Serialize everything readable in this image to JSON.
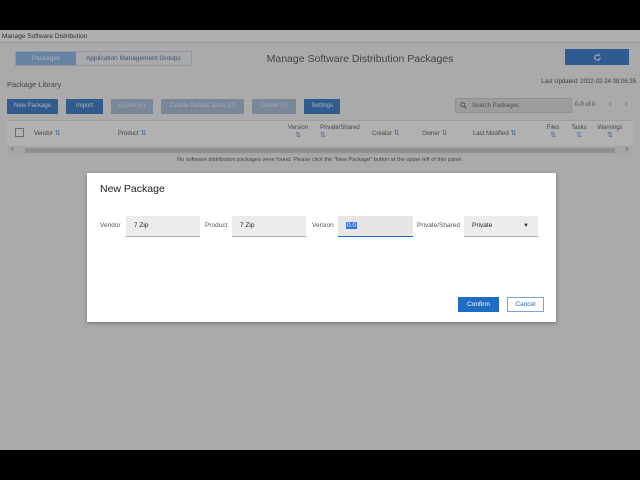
{
  "window": {
    "title": "Manage Software Distribution"
  },
  "tabs": [
    {
      "label": "Packages",
      "active": true
    },
    {
      "label": "Application Management Groups",
      "active": false
    }
  ],
  "header": {
    "title": "Manage Software Distribution Packages",
    "refresh_icon": "refresh-icon"
  },
  "library": {
    "title": "Package Library",
    "last_updated": "Last Updated: 2022-02-24 08:06:35"
  },
  "toolbar": {
    "new_package": "New Package",
    "import": "Import",
    "export": "Export (0)",
    "create_default_tasks": "Create Default Tasks (0)",
    "delete": "Delete (0)",
    "settings": "Settings"
  },
  "search": {
    "placeholder": "Search Packages"
  },
  "pager": {
    "text": "0-0 of 0"
  },
  "table": {
    "columns": [
      "Vendor",
      "Product",
      "Version",
      "Private/Shared",
      "Creator",
      "Owner",
      "Last Modified",
      "Files",
      "Tasks",
      "Warnings"
    ],
    "empty_message": "No software distribution packages were found. Please click the \"New Package\" button at the upper left of this panel."
  },
  "modal": {
    "title": "New Package",
    "vendor_label": "Vendor",
    "vendor_value": "7 Zip",
    "product_label": "Product",
    "product_value": "7 Zip",
    "version_label": "Version",
    "version_value": "0.0",
    "private_label": "Private/Shared",
    "private_value": "Private",
    "confirm": "Confirm",
    "cancel": "Cancel"
  },
  "colors": {
    "accent": "#1f6cc4",
    "disabled": "#9db8d6",
    "overlay": "#464646"
  }
}
